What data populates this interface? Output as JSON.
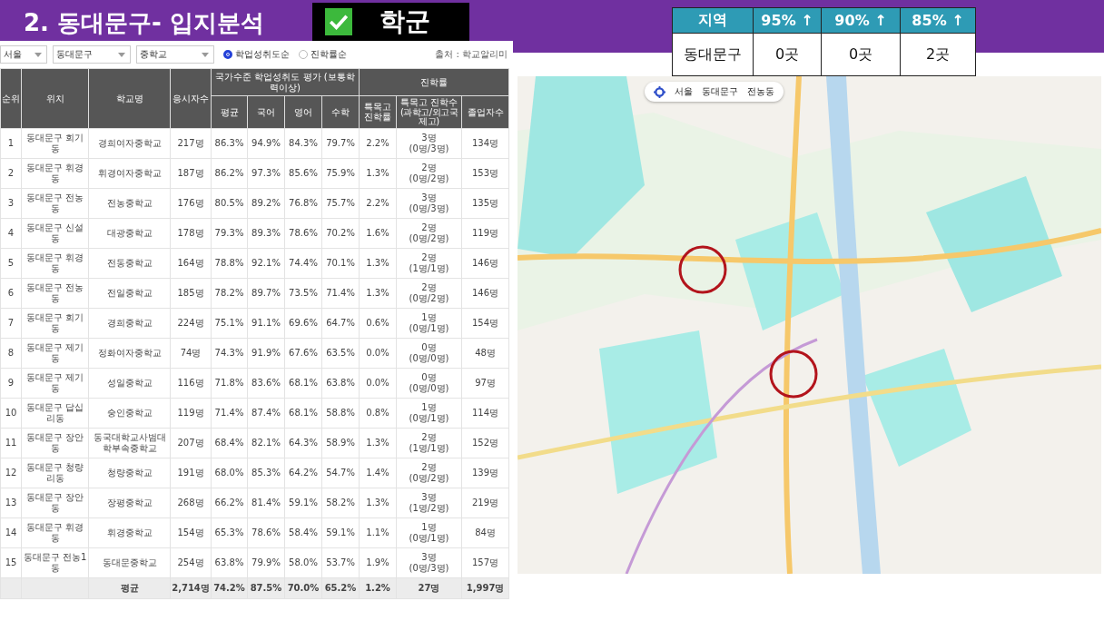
{
  "title": "2. 동대문구- 입지분석",
  "badge": {
    "checked": true,
    "label": "학군"
  },
  "summary_table": {
    "columns": [
      "지역",
      "95% ↑",
      "90% ↑",
      "85% ↑"
    ],
    "rows": [
      [
        "동대문구",
        "0곳",
        "0곳",
        "2곳"
      ]
    ]
  },
  "filters": {
    "dropdowns": [
      "서울",
      "동대문구",
      "중학교"
    ],
    "sort_options": [
      {
        "label": "학업성취도순",
        "selected": true
      },
      {
        "label": "진학률순",
        "selected": false
      }
    ],
    "source": "출처 : 학교알리미"
  },
  "school_table": {
    "columns": [
      {
        "label": "순위"
      },
      {
        "label": "위치"
      },
      {
        "label": "학교명"
      },
      {
        "label": "응시자수"
      }
    ],
    "groups": [
      {
        "label": "국가수준 학업성취도 평가 (보통학력이상)",
        "columns": [
          {
            "label": "평균"
          },
          {
            "label": "국어"
          },
          {
            "label": "영어"
          },
          {
            "label": "수학"
          }
        ]
      },
      {
        "label": "진학률",
        "columns": [
          {
            "label": "특목고 진학률"
          },
          {
            "label": "특목고 진학수",
            "note": "(과학고/외고국제고)"
          },
          {
            "label": "졸업자수"
          }
        ]
      }
    ],
    "rows": [
      [
        "1",
        "동대문구 회기동",
        "경희여자중학교",
        "217명",
        "86.3%",
        "94.9%",
        "84.3%",
        "79.7%",
        "2.2%",
        "3명\n(0명/3명)",
        "134명"
      ],
      [
        "2",
        "동대문구 휘경동",
        "휘경여자중학교",
        "187명",
        "86.2%",
        "97.3%",
        "85.6%",
        "75.9%",
        "1.3%",
        "2명\n(0명/2명)",
        "153명"
      ],
      [
        "3",
        "동대문구 전농동",
        "전농중학교",
        "176명",
        "80.5%",
        "89.2%",
        "76.8%",
        "75.7%",
        "2.2%",
        "3명\n(0명/3명)",
        "135명"
      ],
      [
        "4",
        "동대문구 신설동",
        "대광중학교",
        "178명",
        "79.3%",
        "89.3%",
        "78.6%",
        "70.2%",
        "1.6%",
        "2명\n(0명/2명)",
        "119명"
      ],
      [
        "5",
        "동대문구 휘경동",
        "전동중학교",
        "164명",
        "78.8%",
        "92.1%",
        "74.4%",
        "70.1%",
        "1.3%",
        "2명\n(1명/1명)",
        "146명"
      ],
      [
        "6",
        "동대문구 전농동",
        "전일중학교",
        "185명",
        "78.2%",
        "89.7%",
        "73.5%",
        "71.4%",
        "1.3%",
        "2명\n(0명/2명)",
        "146명"
      ],
      [
        "7",
        "동대문구 회기동",
        "경희중학교",
        "224명",
        "75.1%",
        "91.1%",
        "69.6%",
        "64.7%",
        "0.6%",
        "1명\n(0명/1명)",
        "154명"
      ],
      [
        "8",
        "동대문구 제기동",
        "정화여자중학교",
        "74명",
        "74.3%",
        "91.9%",
        "67.6%",
        "63.5%",
        "0.0%",
        "0명\n(0명/0명)",
        "48명"
      ],
      [
        "9",
        "동대문구 제기동",
        "성일중학교",
        "116명",
        "71.8%",
        "83.6%",
        "68.1%",
        "63.8%",
        "0.0%",
        "0명\n(0명/0명)",
        "97명"
      ],
      [
        "10",
        "동대문구 답십리동",
        "숭인중학교",
        "119명",
        "71.4%",
        "87.4%",
        "68.1%",
        "58.8%",
        "0.8%",
        "1명\n(0명/1명)",
        "114명"
      ],
      [
        "11",
        "동대문구 장안동",
        "동국대학교사범대학부속중학교",
        "207명",
        "68.4%",
        "82.1%",
        "64.3%",
        "58.9%",
        "1.3%",
        "2명\n(1명/1명)",
        "152명"
      ],
      [
        "12",
        "동대문구 청량리동",
        "청량중학교",
        "191명",
        "68.0%",
        "85.3%",
        "64.2%",
        "54.7%",
        "1.4%",
        "2명\n(0명/2명)",
        "139명"
      ],
      [
        "13",
        "동대문구 장안동",
        "장평중학교",
        "268명",
        "66.2%",
        "81.4%",
        "59.1%",
        "58.2%",
        "1.3%",
        "3명\n(1명/2명)",
        "219명"
      ],
      [
        "14",
        "동대문구 휘경동",
        "휘경중학교",
        "154명",
        "65.3%",
        "78.6%",
        "58.4%",
        "59.1%",
        "1.1%",
        "1명\n(0명/1명)",
        "84명"
      ],
      [
        "15",
        "동대문구 전농1동",
        "동대문중학교",
        "254명",
        "63.8%",
        "79.9%",
        "58.0%",
        "53.7%",
        "1.9%",
        "3명\n(0명/3명)",
        "157명"
      ]
    ],
    "footer": {
      "label": "평균",
      "values": [
        "2,714명",
        "74.2%",
        "87.5%",
        "70.0%",
        "65.2%",
        "1.2%",
        "27명",
        "1,997명"
      ]
    }
  },
  "map": {
    "kind": "picture",
    "breadcrumbs": [
      "서울",
      "동대문구",
      "전농동"
    ]
  }
}
